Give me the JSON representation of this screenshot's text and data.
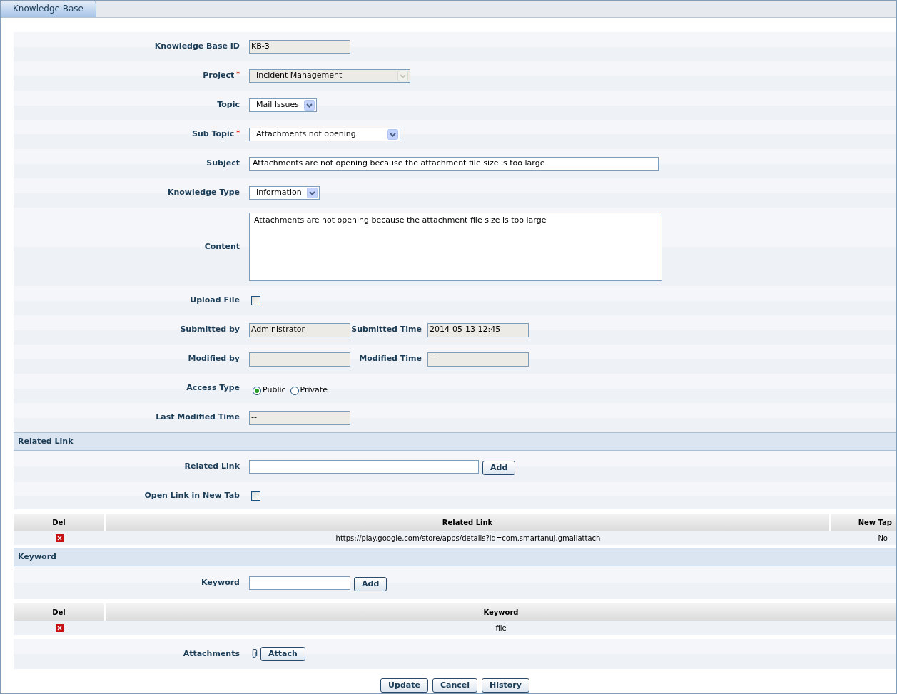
{
  "tab": {
    "label": "Knowledge Base",
    "selected": true
  },
  "fields": [
    {
      "kind": "readonly",
      "label": "Knowledge Base ID",
      "value": "KB-3"
    },
    {
      "kind": "select",
      "label": "Project",
      "value": "Incident Management",
      "required_mark": "*",
      "disabled": true
    },
    {
      "kind": "select",
      "label": "Topic",
      "value": "Mail Issues",
      "disabled": false
    },
    {
      "kind": "select",
      "label": "Sub Topic",
      "value": "Attachments not opening",
      "required_mark": "*",
      "disabled": false
    },
    {
      "kind": "text",
      "label": "Subject",
      "value": "Attachments are not opening because the attachment file size is too large"
    },
    {
      "kind": "select",
      "label": "Knowledge Type",
      "value": "Information",
      "disabled": false
    },
    {
      "kind": "textarea",
      "label": "Content",
      "value": "Attachments are not opening because the attachment file size is too large"
    },
    {
      "kind": "checkbox",
      "label": "Upload File",
      "checked": false
    },
    {
      "kind": "pair",
      "label": "Submitted by",
      "value": "Administrator",
      "label2": "Submitted Time",
      "value2": "2014-05-13 12:45"
    },
    {
      "kind": "pair",
      "label": "Modified by",
      "value": "--",
      "label2": "Modified Time",
      "value2": "--"
    },
    {
      "kind": "radio",
      "label": "Access Type",
      "options": [
        {
          "label": "Public",
          "selected": true
        },
        {
          "label": "Private",
          "selected": false
        }
      ]
    },
    {
      "kind": "readonly",
      "label": "Last Modified Time",
      "value": "--"
    }
  ],
  "related_link": {
    "title": "Related Link",
    "field_label": "Related Link",
    "button": "Add",
    "new_tab": {
      "label": "Open Link in New Tab",
      "checked": false
    },
    "columns": [
      "Del",
      "Related Link",
      "New Tap"
    ],
    "rows": [
      {
        "link": "https://play.google.com/store/apps/details?id=com.smartanuj.gmailattach",
        "new_tab": "No"
      }
    ]
  },
  "keyword": {
    "title": "Keyword",
    "field_label": "Keyword",
    "button": "Add",
    "columns": [
      "Del",
      "Keyword"
    ],
    "rows": [
      {
        "keyword": "file"
      }
    ]
  },
  "attachments": {
    "label": "Attachments",
    "button": "Attach"
  },
  "buttons": [
    "Update",
    "Cancel",
    "History"
  ]
}
